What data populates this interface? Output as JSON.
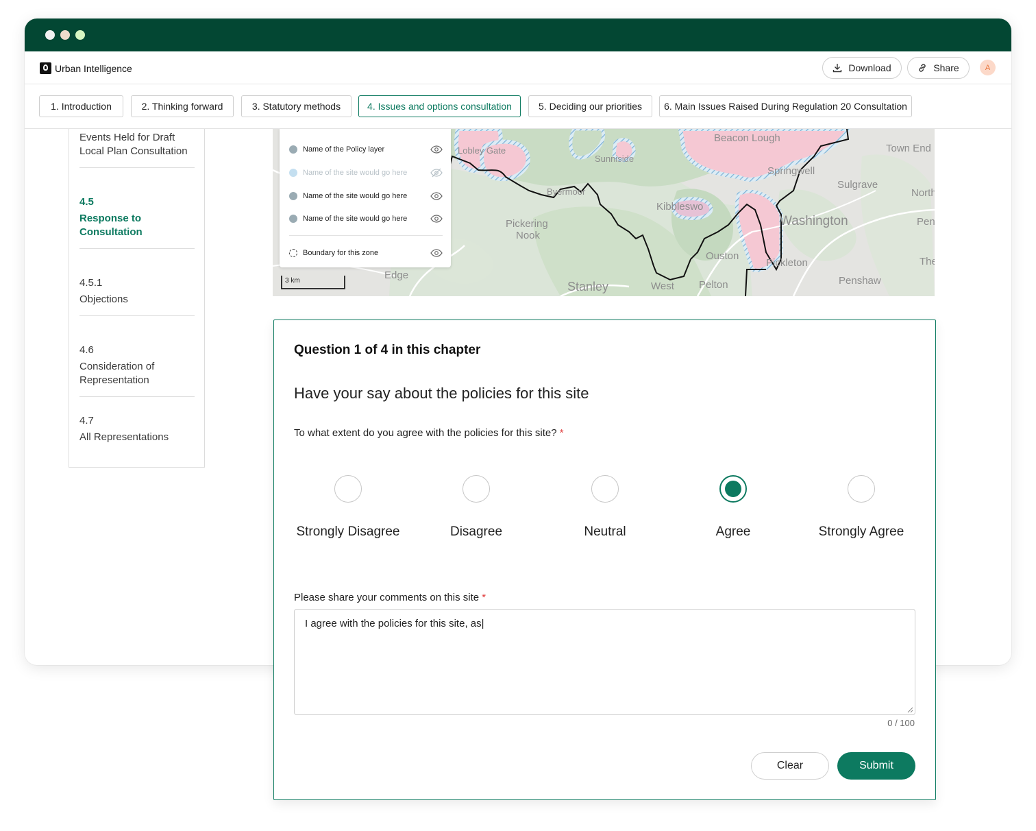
{
  "app": {
    "brand": "Urban Intelligence",
    "avatar_initial": "A"
  },
  "window": {
    "dots": [
      "#f1f1f1",
      "#f1e0d0",
      "#d8f5c4"
    ]
  },
  "toolbar": {
    "download_label": "Download",
    "share_label": "Share"
  },
  "tabs": [
    {
      "label": "1. Introduction"
    },
    {
      "label": "2. Thinking forward"
    },
    {
      "label": "3. Statutory methods"
    },
    {
      "label": "4. Issues and options consultation",
      "active": true
    },
    {
      "label": "5. Deciding our priorities"
    },
    {
      "label": "6. Main Issues Raised During Regulation 20 Consultation"
    }
  ],
  "sidebar": {
    "items": [
      {
        "label": "Events Held for Draft Local Plan Consultation"
      },
      {
        "number": "4.5",
        "label": "Response to Consultation",
        "active": true
      },
      {
        "number": "4.5.1",
        "label": "Objections"
      },
      {
        "number": "4.6",
        "label": "Consideration of Representation"
      },
      {
        "number": "4.7",
        "label": "All Representations"
      }
    ]
  },
  "map": {
    "legend": [
      {
        "label": "Name of the Policy layer",
        "visible": true
      },
      {
        "label": "Name of the site would go here",
        "visible": false
      },
      {
        "label": "Name of the site would go here",
        "visible": true
      },
      {
        "label": "Name of the site would go here",
        "visible": true
      },
      {
        "label": "Boundary for this zone",
        "visible": true
      }
    ],
    "scale": "3 km",
    "places": [
      "Beacon Lough",
      "Town End",
      "Springwell",
      "Sulgrave",
      "North H",
      "Washington",
      "Pen",
      "Pickering Nook",
      "Kibbleswo",
      "Ouston",
      "Pickleton",
      "The",
      "Edge",
      "Stanley",
      "West",
      "Pelton",
      "Penshaw",
      "Sunniside",
      "Byermoor",
      "Lobley Gate"
    ]
  },
  "question": {
    "eyebrow": "Question 1 of 4 in this chapter",
    "title": "Have your say about the policies for this site",
    "agree_label": "To what extent do you agree with the policies for this site?",
    "required_mark": "*",
    "options": [
      "Strongly Disagree",
      "Disagree",
      "Neutral",
      "Agree",
      "Strongly Agree"
    ],
    "selected_option": "Agree",
    "comments_label": "Please share your comments on this site",
    "comments_value": "I agree with the policies for this site, as|",
    "counter": "0 / 100",
    "clear_label": "Clear",
    "submit_label": "Submit"
  },
  "colors": {
    "brand_green": "#034733",
    "accent": "#0d7a60",
    "required": "#e03b3b"
  }
}
